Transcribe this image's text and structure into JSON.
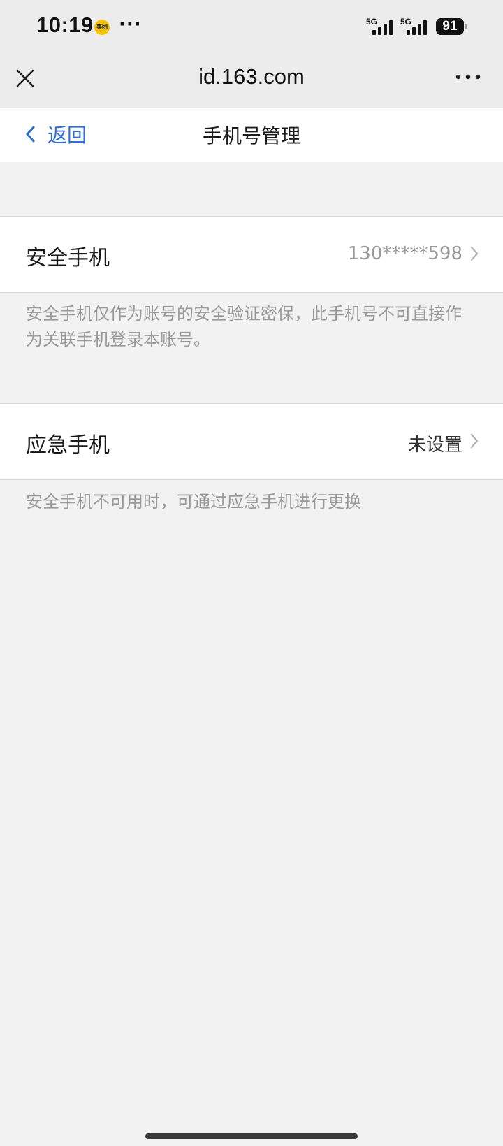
{
  "status_bar": {
    "time": "10:19",
    "app_badge": "美团",
    "more": "···",
    "sim1_network": "5G",
    "sim2_network": "5G",
    "battery": "91"
  },
  "browser": {
    "title": "id.163.com",
    "close_icon": "close-icon",
    "more_icon": "more-horizontal-icon"
  },
  "nav": {
    "back_label": "返回",
    "title": "手机号管理",
    "accent": "#2f6fd6"
  },
  "sections": [
    {
      "label": "安全手机",
      "value": "130*****598",
      "value_color": "#9a9a9a",
      "hint": "安全手机仅作为账号的安全验证密保，此手机号不可直接作为关联手机登录本账号。"
    },
    {
      "label": "应急手机",
      "value": "未设置",
      "value_color": "#333333",
      "hint": "安全手机不可用时，可通过应急手机进行更换"
    }
  ]
}
